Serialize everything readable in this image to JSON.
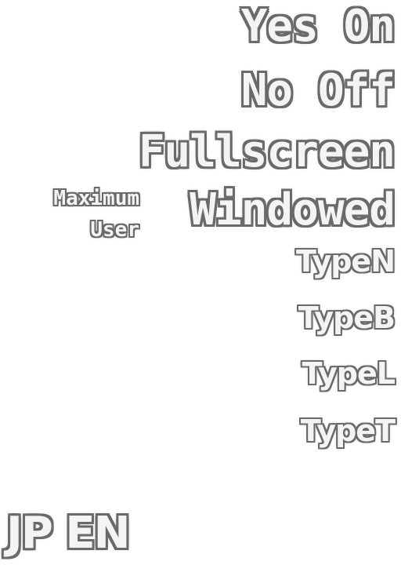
{
  "toggles": {
    "yes_on": "Yes On",
    "no_off": "No Off"
  },
  "display_modes": {
    "fullscreen": "Fullscreen",
    "windowed": "Windowed",
    "maximum": "Maximum",
    "user": "User"
  },
  "types": [
    "TypeN",
    "TypeB",
    "TypeL",
    "TypeT"
  ],
  "languages": {
    "label": "JP EN"
  },
  "colors": {
    "text_fill": "#f4f4f4",
    "outline": "#6a6a6a",
    "background": "#ffffff"
  }
}
